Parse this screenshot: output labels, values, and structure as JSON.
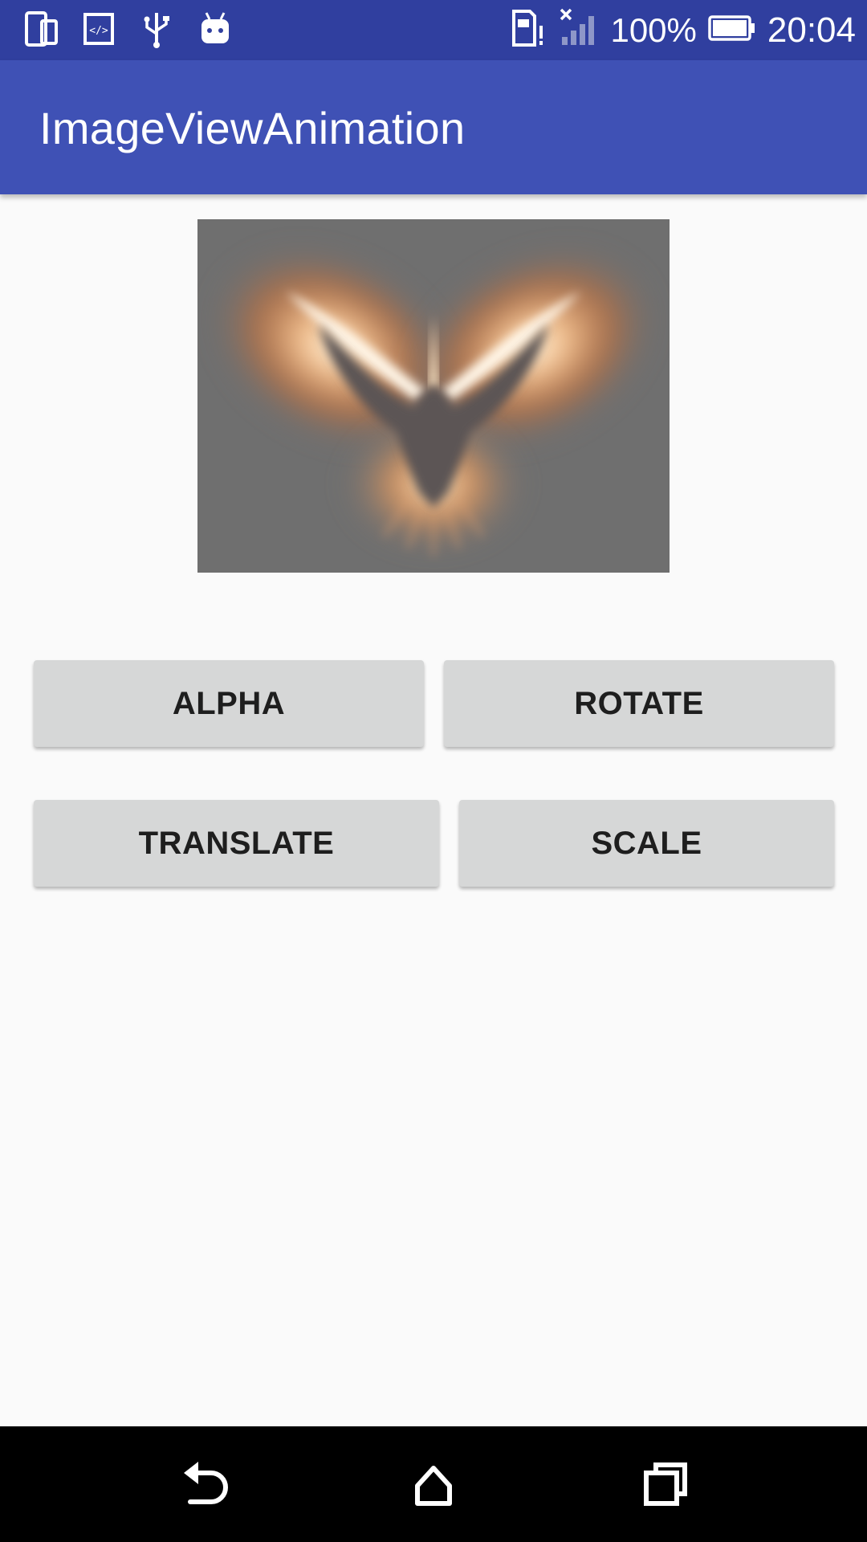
{
  "status_bar": {
    "battery_percent": "100%",
    "time": "20:04",
    "icons_left": [
      "phone-tablet-icon",
      "code-icon",
      "usb-icon",
      "android-icon"
    ],
    "icons_right": [
      "sim-alert-icon",
      "signal-no-service-icon",
      "battery-icon"
    ]
  },
  "app_bar": {
    "title": "ImageViewAnimation",
    "color": "#3f51b5",
    "status_color": "#303f9f"
  },
  "image_view": {
    "subject": "glowing-phoenix-image"
  },
  "buttons": {
    "alpha": "ALPHA",
    "rotate": "ROTATE",
    "translate": "TRANSLATE",
    "scale": "SCALE"
  },
  "nav_bar": {
    "icons": [
      "back-icon",
      "home-icon",
      "recents-icon"
    ]
  }
}
